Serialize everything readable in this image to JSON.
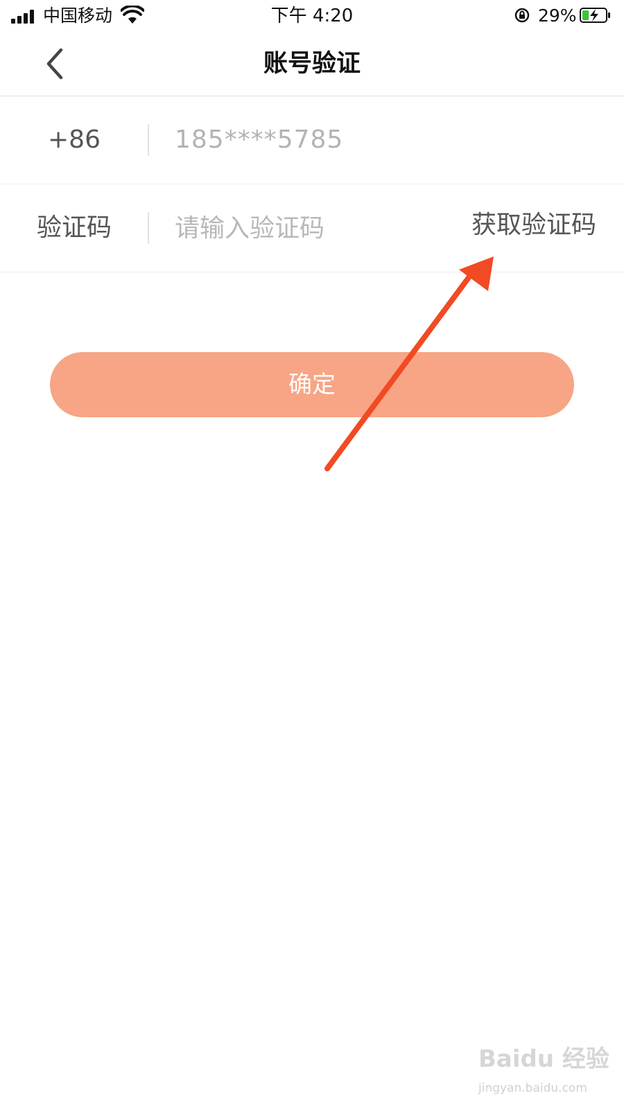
{
  "status_bar": {
    "carrier": "中国移动",
    "time": "下午 4:20",
    "battery": "29%",
    "battery_level": 0.29,
    "icons": [
      "signal-icon",
      "wifi-icon",
      "orientation-lock-icon",
      "battery-charging-icon"
    ]
  },
  "nav": {
    "title": "账号验证",
    "back_icon": "chevron-left-icon"
  },
  "form": {
    "country_code": "+86",
    "phone": "185****5785",
    "code_label": "验证码",
    "code_placeholder": "请输入验证码",
    "code_value": "",
    "get_code_label": "获取验证码"
  },
  "confirm_label": "确定",
  "colors": {
    "accent": "#f7a585",
    "annotation_arrow": "#f24a23",
    "text_secondary": "#555555",
    "placeholder": "#b8b8b8"
  },
  "watermark": {
    "logo": "Baidu 经验",
    "url": "jingyan.baidu.com"
  }
}
